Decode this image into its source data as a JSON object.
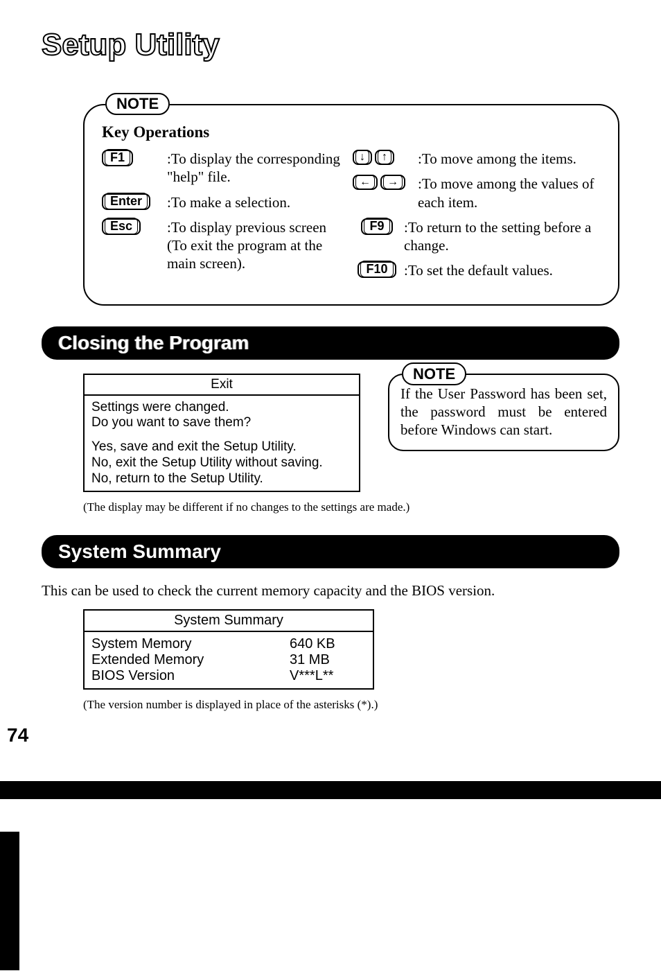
{
  "title": "Setup Utility",
  "note1": {
    "pill": "NOTE",
    "heading": "Key Operations",
    "left": [
      {
        "key": "F1",
        "desc": ":To display the corresponding \"help\" file."
      },
      {
        "key": "Enter",
        "desc": ":To make a selection."
      },
      {
        "key": "Esc",
        "desc": ":To display previous screen (To exit the program at the main screen)."
      }
    ],
    "right": [
      {
        "keys": [
          "↓",
          "↑"
        ],
        "desc": ":To move among the items."
      },
      {
        "keys": [
          "←",
          "→"
        ],
        "desc": ":To move among the values of each item."
      },
      {
        "key": "F9",
        "desc": ":To return to the setting before a change."
      },
      {
        "key": "F10",
        "desc": ":To set the default values."
      }
    ]
  },
  "closing": {
    "bar": "Closing the Program",
    "exit": {
      "title": "Exit",
      "body1": "Settings were changed.\nDo you want to save them?",
      "body2": "Yes, save and exit the Setup Utility.\nNo, exit the Setup Utility without saving.\nNo, return to the Setup Utility."
    },
    "rightNote": {
      "pill": "NOTE",
      "text": "If the User Password has been set, the password must be entered before Windows can start."
    },
    "footnote": "(The display may be different if no changes to the settings are made.)"
  },
  "summary": {
    "bar": "System Summary",
    "intro": "This can be used to check the current memory capacity and the BIOS version.",
    "title": "System Summary",
    "rows": [
      {
        "label": "System Memory",
        "value": "640 KB"
      },
      {
        "label": "Extended Memory",
        "value": "31 MB"
      },
      {
        "label": "BIOS Version",
        "value": "V***L**"
      }
    ],
    "footnote": "(The version number is displayed in place of the asterisks (*).)"
  },
  "page_number": "74"
}
